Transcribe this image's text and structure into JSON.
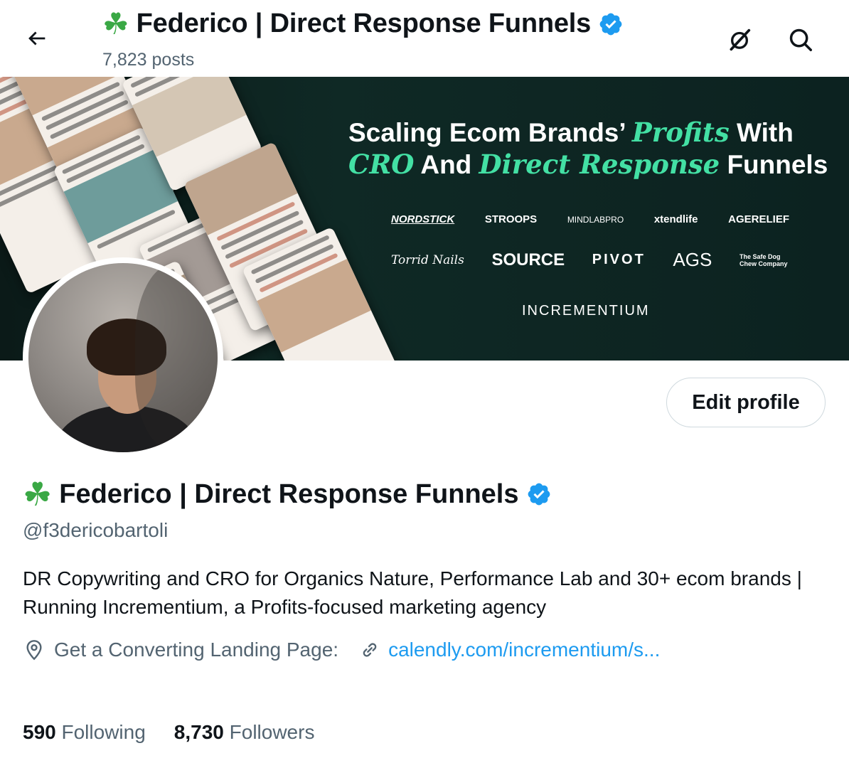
{
  "header": {
    "title_emoji": "☘️",
    "title": "Federico | Direct Response Funnels",
    "posts_count": "7,823 posts",
    "icons": [
      "back-arrow-icon",
      "grok-icon",
      "search-icon"
    ]
  },
  "banner": {
    "headline": {
      "line1_a": "Scaling Ecom Brands’ ",
      "line1_hl": "Profits",
      "line1_b": " With",
      "line2_hl_a": "CRO",
      "line2_a": " And ",
      "line2_hl_b": "Direct Response",
      "line2_b": " Funnels"
    },
    "logos_row1": [
      "NORDSTICK",
      "STROOPS",
      "MINDLABPRO",
      "xtendlife",
      "AGERELIEF"
    ],
    "logos_row2": [
      "Torrid Nails",
      "SOURCE",
      "PIVOT",
      "AGS",
      "The Safe Dog Chew Company"
    ],
    "brand": "INCREMENTIUM"
  },
  "profile": {
    "edit_label": "Edit profile",
    "name_emoji": "☘️",
    "name": "Federico | Direct Response Funnels",
    "handle": "@f3dericobartoli",
    "bio": "DR Copywriting and CRO for Organics Nature, Performance Lab and 30+ ecom brands | Running Incrementium, a Profits-focused marketing agency",
    "location": "Get a Converting Landing Page:",
    "link": "calendly.com/incrementium/s..."
  },
  "stats": {
    "following_count": "590",
    "following_label": "Following",
    "followers_count": "8,730",
    "followers_label": "Followers"
  },
  "colors": {
    "accent": "#1d9bf0",
    "verified": "#1d9bf0",
    "banner_highlight": "#43e0a4",
    "clover": "#3aa845"
  }
}
